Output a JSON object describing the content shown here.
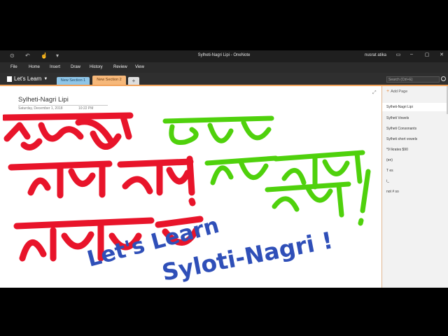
{
  "window": {
    "title": "Sylheti-Nagri Lipi  -  OneNote",
    "user": "nusrat atika"
  },
  "menu": [
    "File",
    "Home",
    "Insert",
    "Draw",
    "History",
    "Review",
    "View"
  ],
  "notebook": {
    "name": "Let's Learn"
  },
  "sections": [
    {
      "label": "New Section 1",
      "color": "#8fc6e8"
    },
    {
      "label": "New Section 2",
      "color": "#f6b87a"
    }
  ],
  "search": {
    "placeholder": "Search (Ctrl+E)"
  },
  "page": {
    "title": "Sylheti-Nagri Lipi",
    "date": "Saturday, December 1, 2018",
    "time": "10:22 PM"
  },
  "ink": {
    "english_line1": "Let's Learn",
    "english_line2": "Syloti-Nagri !",
    "red_color": "#e8142a",
    "green_color": "#4fd10c",
    "blue_color": "#2f4fb8"
  },
  "pages_panel": {
    "add_page": "Add Page",
    "pages": [
      "Sylheti-Nagri Lipi",
      "Sylheti Vowels",
      "Sylheti Consonants",
      "Sylheti short vowels",
      "*9 Ikrates $90",
      "(en)",
      "T es",
      "i_",
      "not # so"
    ]
  },
  "colors": {
    "accent": "#f3a35a",
    "titlebar": "#1f1f1f",
    "menubar": "#2b2b2b"
  }
}
